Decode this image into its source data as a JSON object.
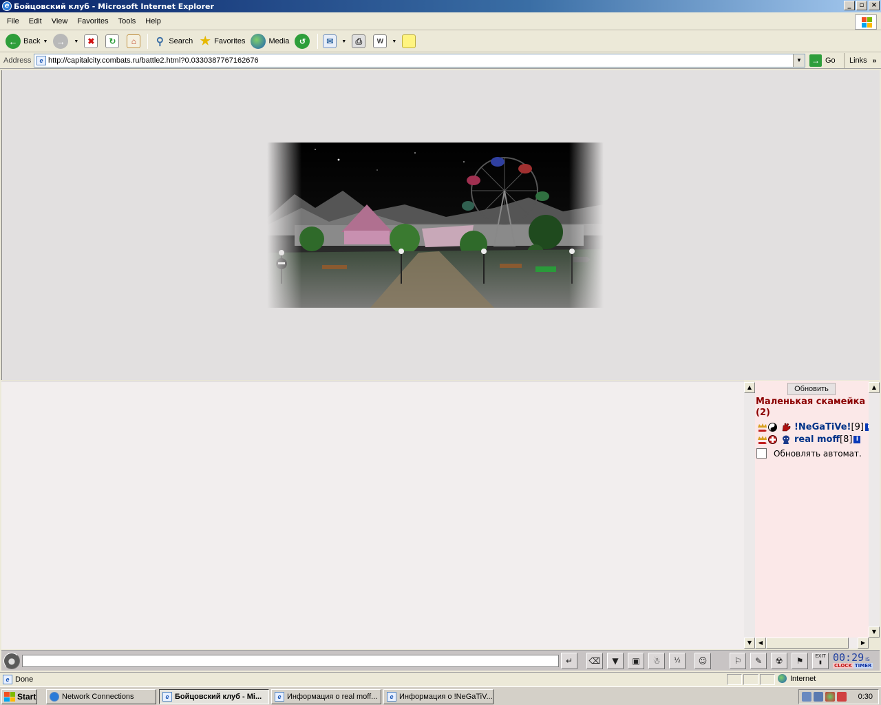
{
  "window": {
    "title": "Бойцовский клуб - Microsoft Internet Explorer",
    "controls": [
      "_",
      "▫",
      "×"
    ]
  },
  "menu": [
    "File",
    "Edit",
    "View",
    "Favorites",
    "Tools",
    "Help"
  ],
  "toolbar": {
    "back": "Back",
    "search": "Search",
    "favorites": "Favorites",
    "media": "Media"
  },
  "address": {
    "label": "Address",
    "url": "http://capitalcity.combats.ru/battle2.html?0.0330387767162676",
    "go": "Go",
    "links": "Links"
  },
  "side": {
    "refresh_label": "Обновить",
    "location": "Маленькая скамейка (2)",
    "players": [
      {
        "nick": "!NeGaTiVe!",
        "level": "[9]"
      },
      {
        "nick": "real moff",
        "level": "[8]"
      }
    ],
    "auto_refresh": "Обновлять автомат."
  },
  "gamebar": {
    "clock": "00:29",
    "clock_suffix": "IS",
    "clock_label": "CLOCK",
    "timer_label": "TIMER",
    "exit_label": "EXIT"
  },
  "status": {
    "text": "Done",
    "zone": "Internet"
  },
  "taskbar": {
    "start": "Start",
    "tasks": [
      "Network Connections",
      "Бойцовский клуб - Mi...",
      "Информация о real moff...",
      "Информация о !NeGaTiV..."
    ],
    "clock": "0:30"
  },
  "colors": {
    "title_gradient_start": "#0a246a",
    "location_text": "#8b0000",
    "nick_text": "#003388",
    "chat_bg": "#f2eeee",
    "side_bg": "#fbe8e8"
  }
}
